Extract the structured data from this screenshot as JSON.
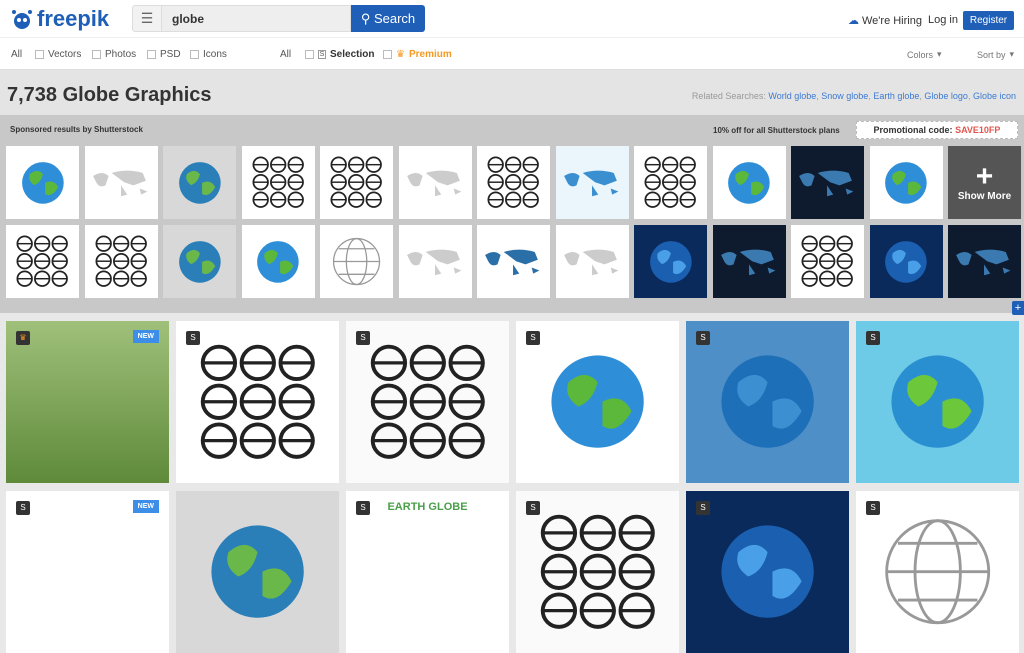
{
  "header": {
    "logo": "freepik",
    "search_value": "globe",
    "search_label": "Search",
    "hiring": "We're Hiring",
    "login": "Log in",
    "register": "Register"
  },
  "filters": {
    "type_all": "All",
    "vectors": "Vectors",
    "photos": "Photos",
    "psd": "PSD",
    "icons": "Icons",
    "lic_all": "All",
    "selection": "Selection",
    "premium": "Premium",
    "colors": "Colors",
    "sort": "Sort by"
  },
  "results": {
    "title": "7,738 Globe Graphics",
    "related_label": "Related Searches:",
    "related": [
      "World globe",
      "Snow globe",
      "Earth globe",
      "Globe logo",
      "Globe icon"
    ]
  },
  "sponsored": {
    "label": "Sponsored results by Shutterstock",
    "offer": "10% off for all Shutterstock plans",
    "promo_label": "Promotional code:",
    "promo_code": "SAVE10FP",
    "show_more": "Show More",
    "row1": [
      "globe",
      "map-white",
      "globe-grey",
      "icons",
      "icons",
      "map-white",
      "icons",
      "map-light",
      "icons",
      "globe",
      "dark",
      "globe",
      "showmore"
    ],
    "row2": [
      "icons",
      "icons",
      "globe-grey",
      "globe",
      "wire",
      "map-white",
      "map-blue",
      "map-white",
      "dark-blue",
      "dark",
      "icons",
      "dark-blue",
      "dark"
    ]
  },
  "grid": {
    "new_label": "NEW",
    "row1": [
      {
        "kind": "photo",
        "badge": "crown",
        "new": true
      },
      {
        "kind": "icons",
        "badge": "S"
      },
      {
        "kind": "icons-white",
        "badge": "S"
      },
      {
        "kind": "globe",
        "badge": "S"
      },
      {
        "kind": "globe-blue",
        "badge": "S"
      },
      {
        "kind": "globe-cyan",
        "badge": "S"
      }
    ],
    "row2": [
      {
        "kind": "white",
        "badge": "S",
        "new": true
      },
      {
        "kind": "globe-grey",
        "badge": ""
      },
      {
        "kind": "white",
        "badge": "S",
        "text": "EARTH GLOBE"
      },
      {
        "kind": "icons-white",
        "badge": "S"
      },
      {
        "kind": "dark-blue",
        "badge": "S"
      },
      {
        "kind": "wire",
        "badge": "S"
      }
    ]
  },
  "colors": {
    "brand": "#1f5fb8",
    "premium": "#f59a23",
    "promo": "#e0574f",
    "link": "#3b7ad1"
  }
}
